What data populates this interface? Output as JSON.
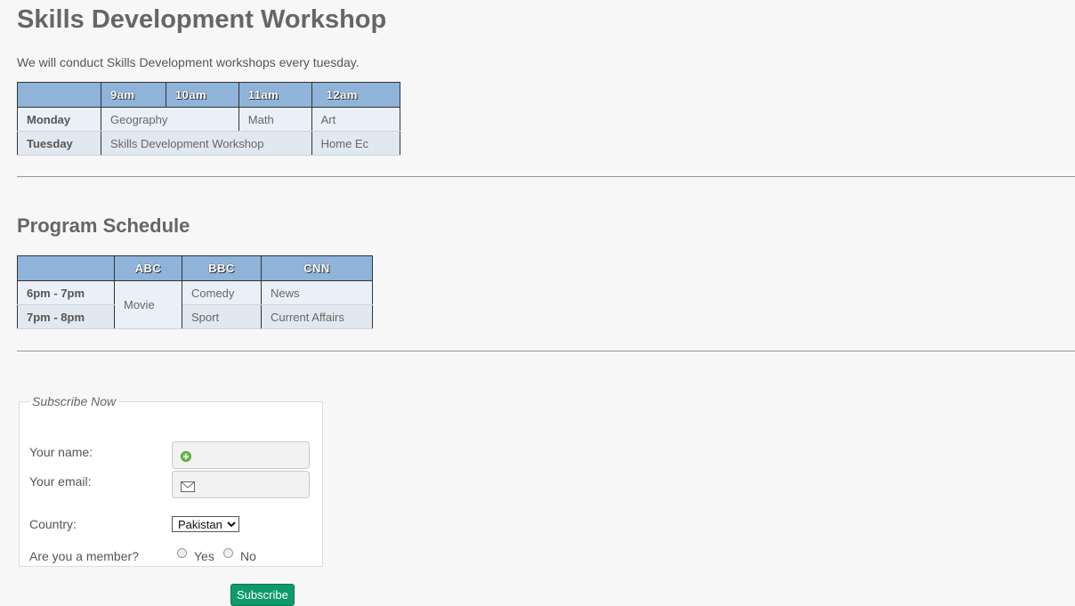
{
  "workshop": {
    "title": "Skills Development Workshop",
    "intro": "We will conduct Skills Development workshops every tuesday.",
    "table": {
      "headers": [
        "",
        "9am",
        "10am",
        "11am",
        "12am"
      ],
      "monday": {
        "day": "Monday",
        "geography": "Geography",
        "math": "Math",
        "art": "Art"
      },
      "tuesday": {
        "day": "Tuesday",
        "workshop": "Skills Development Workshop",
        "home_ec": "Home Ec"
      }
    }
  },
  "program": {
    "title": "Program Schedule",
    "table": {
      "headers": [
        "",
        "ABC",
        "BBC",
        "CNN"
      ],
      "rows": [
        {
          "time": "6pm - 7pm",
          "abc": "Movie",
          "bbc": "Comedy",
          "cnn": "News"
        },
        {
          "time": "7pm - 8pm",
          "bbc": "Sport",
          "cnn": "Current Affairs"
        }
      ]
    }
  },
  "subscribe": {
    "legend": "Subscribe Now",
    "name_label": "Your name:",
    "email_label": "Your email:",
    "country_label": "Country:",
    "country_selected": "Pakistan",
    "member_label": "Are you a member?",
    "yes_label": "Yes",
    "no_label": "No",
    "button_label": "Subscribe",
    "name_icon": "add-user-icon",
    "email_icon": "envelope-icon"
  },
  "colors": {
    "header_bg": "#8fb3d9",
    "button_bg": "#0f9a6a"
  }
}
